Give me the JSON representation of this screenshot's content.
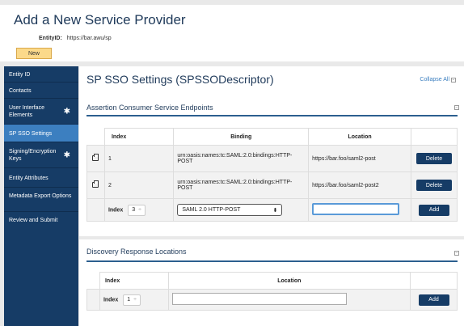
{
  "header": {
    "title": "Add a New Service Provider",
    "entity_label": "EntityID:",
    "entity_value": "https://bar.awu/sp",
    "new_label": "New"
  },
  "sidebar": {
    "items": [
      {
        "label": "Entity ID",
        "star": ""
      },
      {
        "label": "Contacts",
        "star": ""
      },
      {
        "label": "User Interface Elements",
        "star": "✱"
      },
      {
        "label": "SP SSO Settings",
        "star": ""
      },
      {
        "label": "Signing/Encryption Keys",
        "star": "✱"
      },
      {
        "label": "Entity Attributes",
        "star": ""
      },
      {
        "label": "Metadata Export Options",
        "star": ""
      },
      {
        "label": "Review and Submit",
        "star": ""
      }
    ]
  },
  "main": {
    "title": "SP SSO Settings (SPSSODescriptor)",
    "collapse_all": "Collapse All",
    "acs": {
      "title": "Assertion Consumer Service Endpoints",
      "headers": {
        "index": "Index",
        "binding": "Binding",
        "location": "Location"
      },
      "rows": [
        {
          "index": "1",
          "binding": "urn:oasis:names:tc:SAML:2.0:bindings:HTTP-POST",
          "location": "https://bar.foo/saml2-post",
          "action": "Delete"
        },
        {
          "index": "2",
          "binding": "urn:oasis:names:tc:SAML:2.0:bindings:HTTP-POST",
          "location": "https://bar.foo/saml2-post2",
          "action": "Delete"
        }
      ],
      "new_row": {
        "index_label": "Index",
        "index_value": "3",
        "binding_value": "SAML 2.0 HTTP-POST",
        "location_value": "",
        "action": "Add"
      }
    },
    "drl": {
      "title": "Discovery Response Locations",
      "headers": {
        "index": "Index",
        "location": "Location"
      },
      "new_row": {
        "index_label": "Index",
        "index_value": "1",
        "location_value": "",
        "action": "Add"
      }
    }
  },
  "colors": {
    "navy": "#163c66",
    "active": "#3c7fc0",
    "new_bg": "#fbd98a"
  }
}
